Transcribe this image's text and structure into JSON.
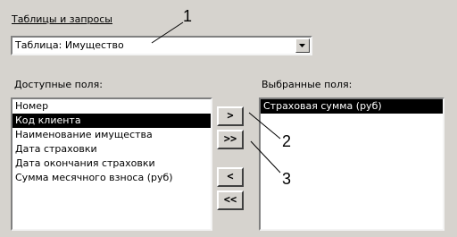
{
  "source_group": {
    "label": "Таблицы и запросы",
    "selected_value": "Таблица: Имущество"
  },
  "available_fields": {
    "label": "Доступные поля:",
    "items": [
      "Номер",
      "Код клиента",
      "Наименование имущества",
      "Дата  страховки",
      "Дата окончания страховки",
      "Сумма месячного взноса (руб)"
    ],
    "selected_index": 1
  },
  "selected_fields": {
    "label": "Выбранные поля:",
    "items": [
      "Страховая сумма (руб)"
    ],
    "selected_index": 0
  },
  "buttons": {
    "add_one": ">",
    "add_all": ">>",
    "remove_one": "<",
    "remove_all": "<<"
  },
  "callouts": [
    "1",
    "2",
    "3"
  ]
}
